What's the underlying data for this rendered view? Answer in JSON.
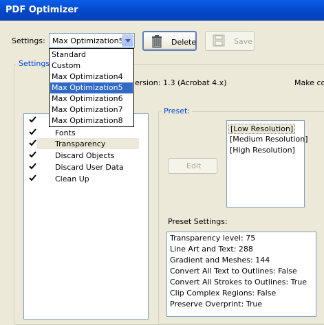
{
  "window": {
    "title": "PDF Optimizer"
  },
  "settings": {
    "label": "Settings:",
    "selected": "Max Optimization5",
    "options": [
      "Standard",
      "Custom",
      "Max Optimization4",
      "Max Optimization5",
      "Max Optimization6",
      "Max Optimization7",
      "Max Optimization8"
    ],
    "selected_index": 3
  },
  "toolbar": {
    "delete_label": "Delete",
    "save_label": "Save"
  },
  "settings_group": {
    "title": "Settings",
    "version_text": "ersion: 1.3 (Acrobat 4.x)",
    "make_compat_text": "Make con"
  },
  "options_list": [
    {
      "label": "Fonts",
      "checked": true
    },
    {
      "label": "Transparency",
      "checked": true,
      "selected": true
    },
    {
      "label": "Discard Objects",
      "checked": true
    },
    {
      "label": "Discard User Data",
      "checked": true
    },
    {
      "label": "Clean Up",
      "checked": true
    }
  ],
  "preset": {
    "title": "Preset:",
    "edit_label": "Edit",
    "items": [
      "[Low Resolution]",
      "[Medium Resolution]",
      "[High Resolution]"
    ],
    "selected_index": 0,
    "settings_label": "Preset Settings:",
    "settings_lines": [
      "Transparency level: 75",
      "Line Art and Text: 288",
      "Gradient and Meshes: 144",
      "Convert All Text to Outlines: False",
      "Convert All Strokes to Outlines: True",
      "Clip Complex Regions: False",
      "Preserve Overprint: True"
    ]
  }
}
